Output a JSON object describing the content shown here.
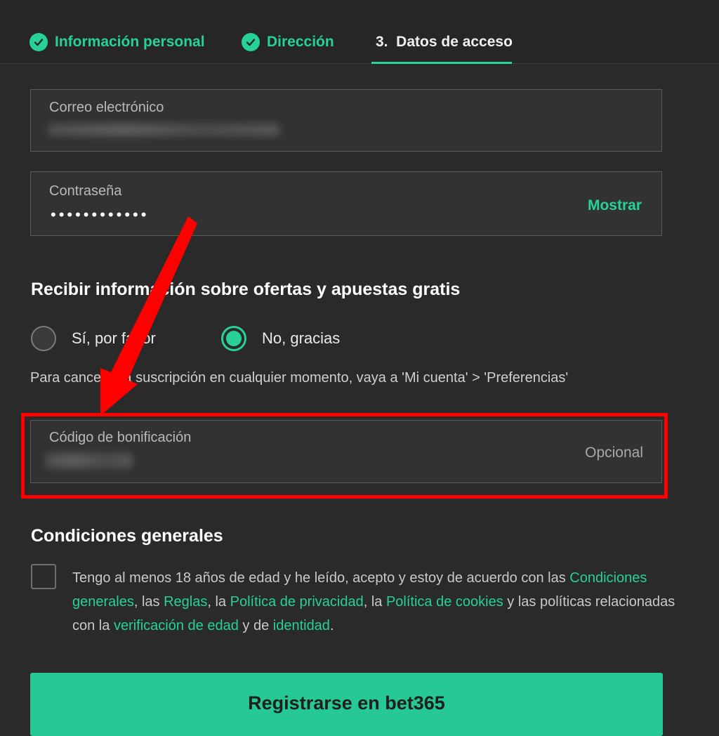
{
  "tabs": [
    {
      "label": "Información personal",
      "state": "done"
    },
    {
      "label": "Dirección",
      "state": "done"
    },
    {
      "label": "3.  Datos de acceso",
      "state": "active"
    }
  ],
  "email": {
    "label": "Correo electrónico"
  },
  "password": {
    "label": "Contraseña",
    "value": "••••••••••••",
    "show_label": "Mostrar"
  },
  "offers": {
    "heading": "Recibir información sobre ofertas y apuestas gratis",
    "yes_label": "Sí, por favor",
    "no_label": "No, gracias",
    "selected": "no",
    "note": "Para cancelar la suscripción en cualquier momento, vaya a 'Mi cuenta' > 'Preferencias'"
  },
  "bonus": {
    "label": "Código de bonificación",
    "optional": "Opcional"
  },
  "conditions": {
    "heading": "Condiciones generales",
    "t1": "Tengo al menos 18 años de edad y he leído, acepto y estoy de acuerdo con las ",
    "link1": "Condiciones generales",
    "t2": ", las ",
    "link2": "Reglas",
    "t3": ", la ",
    "link3": "Política de privacidad",
    "t4": ", la ",
    "link4": "Política de cookies",
    "t5": " y las políticas relacionadas con la ",
    "link5": "verificación de edad",
    "t6": " y de ",
    "link6": "identidad",
    "t7": "."
  },
  "cta": {
    "label": "Registrarse en bet365"
  },
  "colors": {
    "accent": "#26d19a",
    "background": "#2a2a2a",
    "highlight": "#ff0000"
  }
}
